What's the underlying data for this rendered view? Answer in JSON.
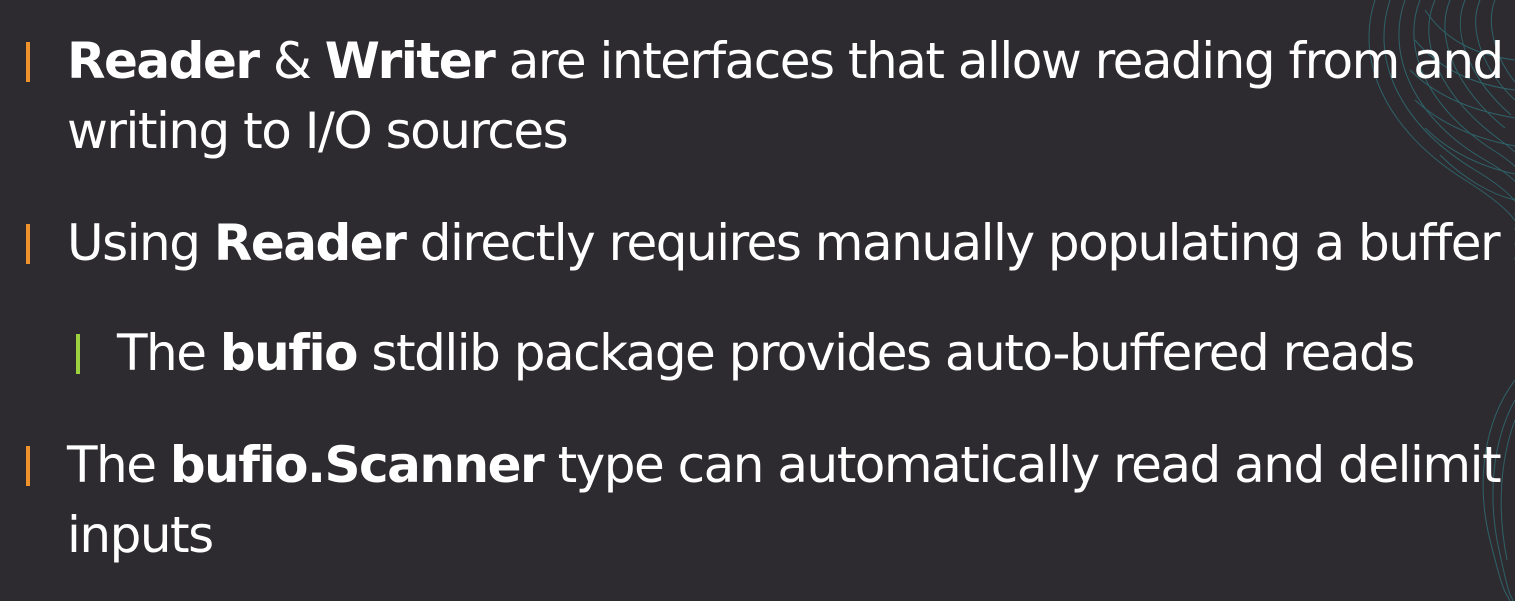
{
  "colors": {
    "background": "#2d2b2f",
    "text": "#ffffff",
    "level1_marker": "#f0922b",
    "level2_marker": "#9bd13e",
    "decoration": "#2f8f9a"
  },
  "bullets": [
    {
      "level": 1,
      "line1": {
        "b1": "Reader",
        "t1": " & ",
        "b2": "Writer",
        "t2": " are interfaces that allow reading from and"
      },
      "line2": "writing to I/O sources"
    },
    {
      "level": 1,
      "line1": {
        "t0": "Using ",
        "b1": "Reader",
        "t1": " directly requires manually populating a buffer"
      }
    },
    {
      "level": 2,
      "line1": {
        "t0": "The ",
        "b1": "bufio",
        "t1": " stdlib package provides auto-buffered reads"
      }
    },
    {
      "level": 1,
      "line1": {
        "t0": "The ",
        "b1": "bufio.Scanner",
        "t1": " type can automatically read and delimit"
      },
      "line2": "inputs"
    }
  ]
}
